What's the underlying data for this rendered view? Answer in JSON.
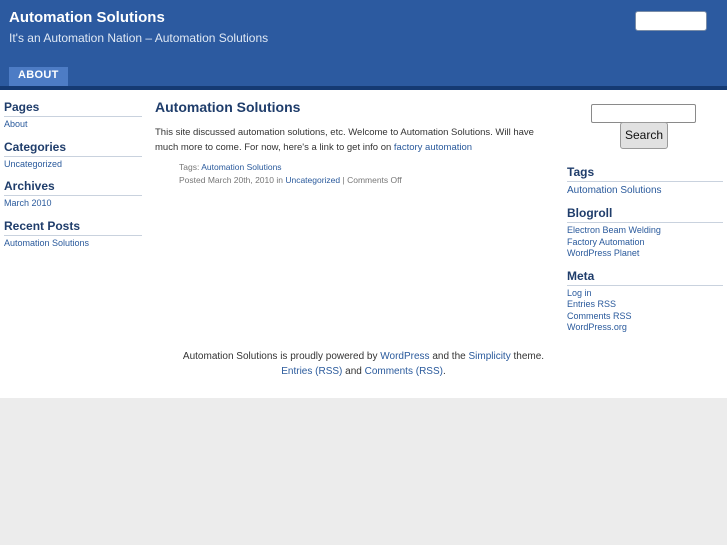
{
  "header": {
    "site_title": "Automation Solutions",
    "tagline": "It's an Automation Nation – Automation Solutions",
    "nav": [
      {
        "label": "ABOUT"
      }
    ]
  },
  "left_sidebar": {
    "pages": {
      "title": "Pages",
      "items": [
        "About"
      ]
    },
    "categories": {
      "title": "Categories",
      "items": [
        "Uncategorized"
      ]
    },
    "archives": {
      "title": "Archives",
      "items": [
        "March 2010"
      ]
    },
    "recent_posts": {
      "title": "Recent Posts",
      "items": [
        "Automation Solutions"
      ]
    }
  },
  "post": {
    "title": "Automation Solutions",
    "body": "This site discussed automation solutions, etc. Welcome to Automation Solutions.  Will have much more to come. For now, here's a link to get info on ",
    "body_link": "factory automation",
    "tags_label": "Tags: ",
    "tags_link": "Automation Solutions",
    "meta_posted": "Posted March 20th, 2010 in ",
    "meta_category": "Uncategorized",
    "meta_sep": " | ",
    "meta_comments": "Comments Off"
  },
  "right_sidebar": {
    "search_button": "Search",
    "tags": {
      "title": "Tags",
      "items": [
        "Automation Solutions"
      ]
    },
    "blogroll": {
      "title": "Blogroll",
      "items": [
        "Electron Beam Welding",
        "Factory Automation",
        "WordPress Planet"
      ]
    },
    "meta": {
      "title": "Meta",
      "items": [
        "Log in",
        "Entries RSS",
        "Comments RSS",
        "WordPress.org"
      ]
    }
  },
  "footer": {
    "text1": "Automation Solutions is proudly powered by ",
    "wordpress": "WordPress",
    "text2": " and the ",
    "simplicity": "Simplicity",
    "text3": " theme.",
    "entries_rss": "Entries (RSS)",
    "and": " and ",
    "comments_rss": "Comments (RSS)",
    "period": "."
  },
  "colors": {
    "header": "#2c5aa0",
    "header_rule": "#153a73",
    "nav_tab": "#4d7cc5",
    "link": "#2a5a9c",
    "heading": "#1f3d6b"
  }
}
